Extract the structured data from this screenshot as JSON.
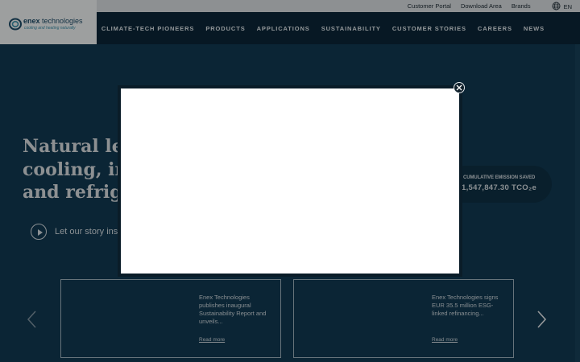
{
  "topbar": {
    "links": [
      "Customer Portal",
      "Download Area",
      "Brands"
    ],
    "language": "EN"
  },
  "logo": {
    "name_bold": "enex",
    "name_rest": " technologies",
    "tagline": "cooling and heating naturally"
  },
  "nav": {
    "items": [
      "CLIMATE-TECH PIONEERS",
      "PRODUCTS",
      "APPLICATIONS",
      "SUSTAINABILITY",
      "CUSTOMER STORIES",
      "CAREERS",
      "NEWS"
    ]
  },
  "hero": {
    "headline_lines": [
      "Natural lea",
      "cooling, inc",
      "and refrige"
    ],
    "story_label": "Let our story ins"
  },
  "emission": {
    "label": "CUMULATIVE EMISSION SAVED",
    "value": "1,547,847.30 TCO₂e"
  },
  "news": [
    {
      "title": "Enex Technologies publishes inaugural Sustainability Report and unveils...",
      "link": "Read more"
    },
    {
      "title": "Enex Technologies signs EUR 35.5 million ESG-linked refinancing...",
      "link": "Read more"
    }
  ],
  "colors": {
    "page_bg": "#0d2a3c",
    "navbar_bg": "#0b2638",
    "topbar_bg": "#d9dde0",
    "modal_bg": "#ffffff"
  },
  "icons": {
    "globe": "globe-icon",
    "play": "play-icon",
    "close": "close-icon",
    "prev": "chevron-left-icon",
    "next": "chevron-right-icon"
  }
}
